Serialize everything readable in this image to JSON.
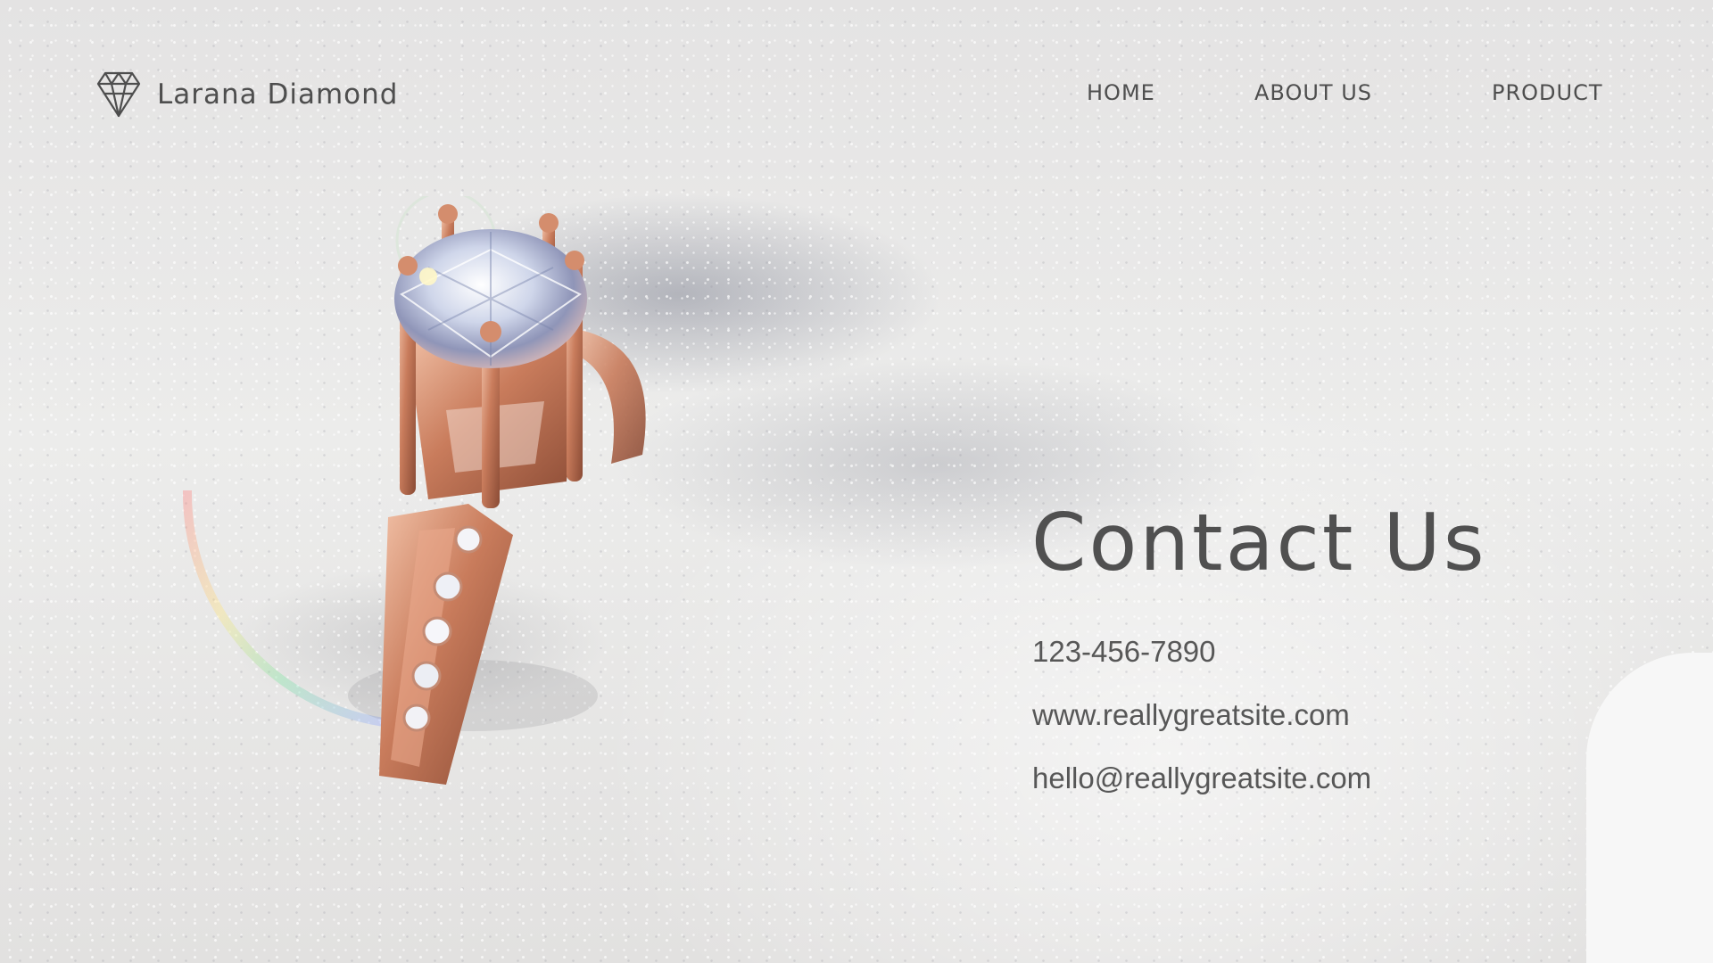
{
  "brand": {
    "name": "Larana Diamond",
    "logo_icon": "diamond-outline-icon"
  },
  "nav": {
    "items": [
      {
        "label": "HOME"
      },
      {
        "label": "ABOUT US"
      },
      {
        "label": "PRODUCT"
      }
    ]
  },
  "contact": {
    "title": "Contact Us",
    "phone": "123-456-7890",
    "website": "www.reallygreatsite.com",
    "email": "hello@reallygreatsite.com"
  },
  "hero": {
    "image": "rose-gold-diamond-ring-in-white-sand"
  },
  "colors": {
    "text": "#505050",
    "background": "#e6e5e4",
    "ring_gold": "#c98466",
    "card": "#f7f7f7"
  }
}
